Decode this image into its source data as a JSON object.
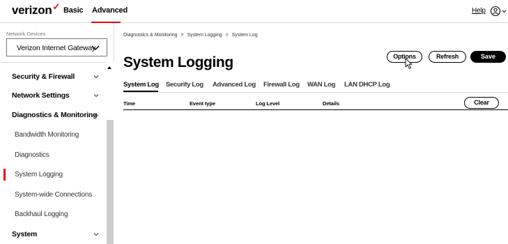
{
  "header": {
    "logo_text": "verizon",
    "logo_check": "✓",
    "mode_basic": "Basic",
    "mode_advanced": "Advanced",
    "help": "Help",
    "accent_color": "#ee0000"
  },
  "sidebar": {
    "network_devices_label": "Network Devices",
    "selected_device": "Verizon Internet Gateway",
    "items": [
      {
        "label": "Security & Firewall",
        "type": "section",
        "expanded": false
      },
      {
        "label": "Network Settings",
        "type": "section",
        "expanded": false
      },
      {
        "label": "Diagnostics & Monitoring",
        "type": "section",
        "expanded": true
      },
      {
        "label": "Bandwidth Monitoring",
        "type": "sub"
      },
      {
        "label": "Diagnostics",
        "type": "sub"
      },
      {
        "label": "System Logging",
        "type": "sub",
        "active": true
      },
      {
        "label": "System-wide Connections",
        "type": "sub"
      },
      {
        "label": "Backhaul Logging",
        "type": "sub"
      },
      {
        "label": "System",
        "type": "section",
        "expanded": false
      }
    ]
  },
  "main": {
    "breadcrumb": [
      "Diagnostics & Monitoring",
      ">",
      "System Logging",
      ">",
      "System Log"
    ],
    "title": "System Logging",
    "buttons": {
      "options": "Options",
      "refresh": "Refresh",
      "save": "Save",
      "clear": "Clear"
    },
    "tabs": [
      {
        "label": "System Log",
        "active": true
      },
      {
        "label": "Security Log"
      },
      {
        "label": "Advanced Log"
      },
      {
        "label": "Firewall Log"
      },
      {
        "label": "WAN Log"
      },
      {
        "label": "LAN DHCP Log"
      }
    ],
    "columns": [
      "Time",
      "Event type",
      "Log Level",
      "Details"
    ]
  }
}
